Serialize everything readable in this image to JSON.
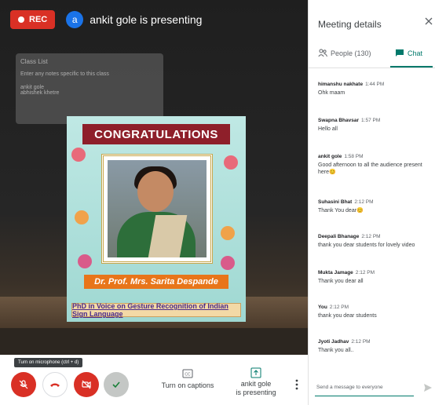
{
  "recording": {
    "label": "REC"
  },
  "presenter": {
    "avatar_letter": "a",
    "text": "ankit gole is presenting"
  },
  "class_list": {
    "header": "Class List",
    "note": "Enter any notes specific to this class",
    "names": [
      "ankit gole",
      "abhishek khetre"
    ]
  },
  "slide": {
    "banner": "CONGRATULATIONS",
    "name": "Dr. Prof. Mrs. Sarita Despande",
    "title": "PhD in Voice on Gesture Recognition of Indian Sign Language"
  },
  "controls": {
    "tooltip": "Turn on microphone (ctrl + d)",
    "captions_label": "Turn on captions",
    "captions_icon_text": "CC",
    "present_label_line1": "ankit gole",
    "present_label_line2": "is presenting"
  },
  "panel": {
    "title": "Meeting details",
    "people_tab": "People (130)",
    "chat_tab": "Chat",
    "composer_placeholder": "Send a message to everyone",
    "accent_color": "#00796b"
  },
  "messages": [
    {
      "sender": "himanshu nakhate",
      "time": "1:44 PM",
      "text": "Ohk maam"
    },
    {
      "sender": "Swapna Bhavsar",
      "time": "1:57 PM",
      "text": "Hello all"
    },
    {
      "sender": "ankit gole",
      "time": "1:58 PM",
      "text": "Good afternoon to all the audience present here😊"
    },
    {
      "sender": "Suhasini Bhat",
      "time": "2:12 PM",
      "text": "Thank You dear😊"
    },
    {
      "sender": "Deepali Bhanage",
      "time": "2:12 PM",
      "text": "thank you dear students for lovely video"
    },
    {
      "sender": "Mukta Jamage",
      "time": "2:12 PM",
      "text": "Thank you dear all"
    },
    {
      "sender": "You",
      "time": "2:12 PM",
      "text": "thank you dear students"
    },
    {
      "sender": "Jyoti Jadhav",
      "time": "2:12 PM",
      "text": "Thank you all.."
    }
  ]
}
